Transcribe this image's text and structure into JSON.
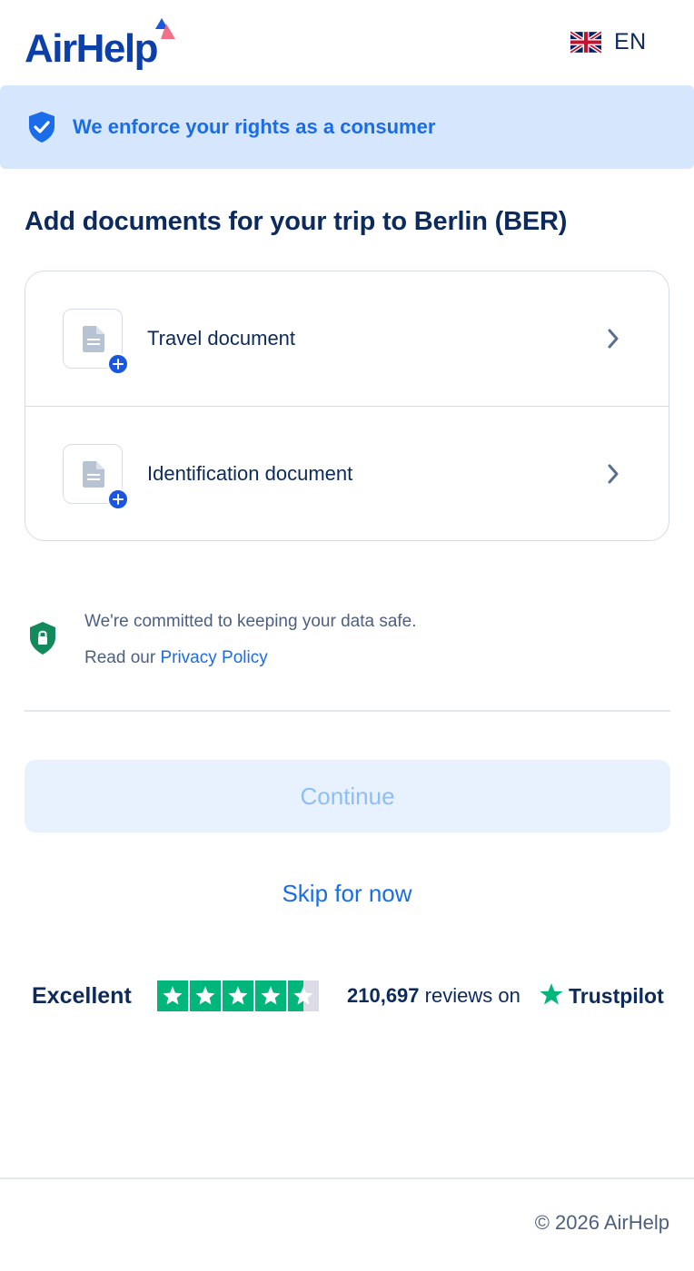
{
  "header": {
    "logo_text": "AirHelp",
    "language": "EN",
    "flag_icon": "uk-flag-icon"
  },
  "banner": {
    "icon": "shield-check-icon",
    "text": "We enforce your rights as a consumer"
  },
  "page_title": "Add documents for your trip to Berlin (BER)",
  "documents": [
    {
      "label": "Travel document",
      "icon": "file-icon",
      "badge_icon": "plus-icon",
      "action_icon": "chevron-right-icon"
    },
    {
      "label": "Identification document",
      "icon": "file-icon",
      "badge_icon": "plus-icon",
      "action_icon": "chevron-right-icon"
    }
  ],
  "privacy": {
    "icon": "lock-shield-icon",
    "line1": "We're committed to keeping your data safe.",
    "line2_prefix": "Read our ",
    "link_label": "Privacy Policy"
  },
  "actions": {
    "continue_label": "Continue",
    "skip_label": "Skip for now"
  },
  "trustpilot": {
    "rating_word": "Excellent",
    "stars": 4.5,
    "review_count": "210,697",
    "reviews_suffix": "reviews on",
    "brand": "Trustpilot"
  },
  "footer": {
    "copyright": "© 2026 AirHelp"
  },
  "colors": {
    "brand_blue": "#0d3fa8",
    "link_blue": "#1a6ce8",
    "banner_bg": "#d6e7fd",
    "trustpilot_green": "#00b67a",
    "privacy_green": "#138a5b"
  }
}
